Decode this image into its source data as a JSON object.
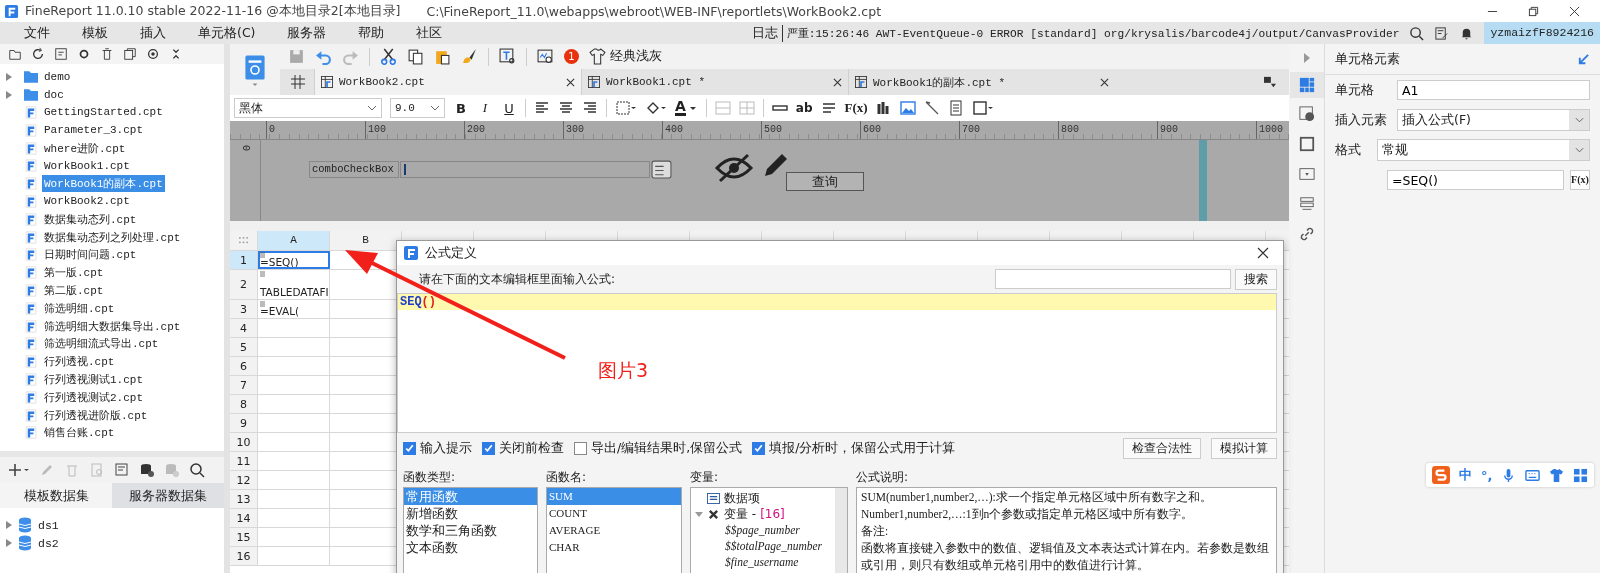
{
  "window": {
    "title": "FineReport 11.0.10 stable 2022-11-16 @本地目录2[本地目录]",
    "path": "C:\\FineReport_11.0\\webapps\\webroot\\WEB-INF\\reportlets\\WorkBook2.cpt"
  },
  "menu": [
    "文件",
    "模板",
    "插入",
    "单元格(C)",
    "服务器",
    "帮助",
    "社区"
  ],
  "status": {
    "log_label": "日志",
    "message": "严重:15:26:46 AWT-EventQueue-0 ERROR [standard] org/krysalis/barcode4j/output/CanvasProvider",
    "user": "yzmaizfF8924216"
  },
  "file_tree": [
    {
      "label": "demo",
      "kind": "folder",
      "selected": false
    },
    {
      "label": "doc",
      "kind": "folder",
      "selected": false
    },
    {
      "label": "GettingStarted.cpt",
      "kind": "file",
      "selected": false
    },
    {
      "label": "Parameter_3.cpt",
      "kind": "file",
      "selected": false
    },
    {
      "label": "where进阶.cpt",
      "kind": "file",
      "selected": false
    },
    {
      "label": "WorkBook1.cpt",
      "kind": "file",
      "selected": false
    },
    {
      "label": "WorkBook1的副本.cpt",
      "kind": "file",
      "selected": true
    },
    {
      "label": "WorkBook2.cpt",
      "kind": "file",
      "selected": false
    },
    {
      "label": "数据集动态列.cpt",
      "kind": "file",
      "selected": false
    },
    {
      "label": "数据集动态列之列处理.cpt",
      "kind": "file",
      "selected": false
    },
    {
      "label": "日期时间问题.cpt",
      "kind": "file",
      "selected": false
    },
    {
      "label": "第一版.cpt",
      "kind": "file",
      "selected": false
    },
    {
      "label": "第二版.cpt",
      "kind": "file",
      "selected": false
    },
    {
      "label": "筛选明细.cpt",
      "kind": "file",
      "selected": false
    },
    {
      "label": "筛选明细大数据集导出.cpt",
      "kind": "file",
      "selected": false
    },
    {
      "label": "筛选明细流式导出.cpt",
      "kind": "file",
      "selected": false
    },
    {
      "label": "行列透视.cpt",
      "kind": "file",
      "selected": false
    },
    {
      "label": "行列透视测试1.cpt",
      "kind": "file",
      "selected": false
    },
    {
      "label": "行列透视测试2.cpt",
      "kind": "file",
      "selected": false
    },
    {
      "label": "行列透视进阶版.cpt",
      "kind": "file",
      "selected": false
    },
    {
      "label": "销售台账.cpt",
      "kind": "file",
      "selected": false
    }
  ],
  "dataset_tabs": [
    {
      "label": "模板数据集",
      "selected": true
    },
    {
      "label": "服务器数据集",
      "selected": false
    }
  ],
  "datasets": [
    "ds1",
    "ds2"
  ],
  "toolbar": {
    "badge": "1",
    "theme_button": "经典浅灰"
  },
  "doc_tabs": [
    {
      "label": "WorkBook2.cpt",
      "selected": true
    },
    {
      "label": "WorkBook1.cpt *",
      "selected": false
    },
    {
      "label": "WorkBook1的副本.cpt *",
      "selected": false
    }
  ],
  "format_bar": {
    "font": "黑体",
    "size": "9.0",
    "style_buttons": [
      "B",
      "I",
      "U"
    ],
    "color_button": "A",
    "wrap_label": "ab",
    "fx_label": "F(x)"
  },
  "designer": {
    "ruler": [
      "0",
      "100",
      "200",
      "300",
      "400",
      "500",
      "600",
      "700",
      "800",
      "900",
      "1000"
    ],
    "vertical_ruler": "0",
    "widget_label": "comboCheckBox",
    "query_button": "查询"
  },
  "sheet": {
    "columns": [
      {
        "label": "A",
        "selected": true
      },
      {
        "label": "B",
        "selected": false
      }
    ],
    "rows": [
      {
        "label": "1",
        "selected": true,
        "cell": "=SEQ()"
      },
      {
        "label": "2",
        "selected": false,
        "cell": "TABLEDATAFI"
      },
      {
        "label": "3",
        "selected": false,
        "cell": "=EVAL("
      },
      {
        "label": "4",
        "selected": false
      },
      {
        "label": "5",
        "selected": false
      },
      {
        "label": "6",
        "selected": false
      },
      {
        "label": "7",
        "selected": false
      },
      {
        "label": "8",
        "selected": false
      },
      {
        "label": "9",
        "selected": false
      },
      {
        "label": "10",
        "selected": false
      },
      {
        "label": "11",
        "selected": false
      },
      {
        "label": "12",
        "selected": false
      },
      {
        "label": "13",
        "selected": false
      },
      {
        "label": "14",
        "selected": false
      },
      {
        "label": "15",
        "selected": false
      },
      {
        "label": "16",
        "selected": false
      }
    ]
  },
  "dialog": {
    "title": "公式定义",
    "prompt": "请在下面的文本编辑框里面输入公式:",
    "search_button": "搜索",
    "formula": {
      "name": "SEQ",
      "args": "()"
    },
    "options": [
      {
        "label": "输入提示",
        "checked": true
      },
      {
        "label": "关闭前检查",
        "checked": true
      },
      {
        "label": "导出/编辑结果时,保留公式",
        "checked": false
      },
      {
        "label": "填报/分析时，保留公式用于计算",
        "checked": true
      }
    ],
    "buttons": [
      "检查合法性",
      "模拟计算"
    ],
    "function_types": {
      "heading": "函数类型:",
      "items": [
        {
          "label": "常用函数",
          "selected": true
        },
        {
          "label": "新增函数",
          "selected": false
        },
        {
          "label": "数学和三角函数",
          "selected": false
        },
        {
          "label": "文本函数",
          "selected": false
        }
      ]
    },
    "function_names": {
      "heading": "函数名:",
      "items": [
        {
          "label": "SUM",
          "selected": true
        },
        {
          "label": "COUNT",
          "selected": false
        },
        {
          "label": "AVERAGE",
          "selected": false
        },
        {
          "label": "CHAR",
          "selected": false
        }
      ]
    },
    "variables": {
      "heading": "变量:",
      "items": [
        {
          "label": "数据项"
        },
        {
          "label": "变量 -",
          "count": "[16]",
          "expanded": true,
          "children": [
            {
              "label": "$$page_number"
            },
            {
              "label": "$$totalPage_number"
            },
            {
              "label": "$fine_username"
            }
          ]
        }
      ]
    },
    "description": {
      "heading": "公式说明:",
      "lines": [
        "SUM(number1,number2,…):求一个指定单元格区域中所有数字之和。",
        "Number1,number2,…:1到n个参数或指定单元格区域中所有数字。",
        "备注:",
        "函数将直接键入参数中的数值、逻辑值及文本表达式计算在内。若参数是数组",
        "或引用，则只有数组或单元格引用中的数值进行计算。"
      ]
    }
  },
  "properties": {
    "heading": "单元格元素",
    "cell_label": "单元格",
    "cell_value": "A1",
    "insert_label": "插入元素",
    "insert_value": "插入公式(F)",
    "format_label": "格式",
    "format_value": "常规",
    "formula_value": "=SEQ()",
    "fx_label": "F(x)"
  },
  "annotation": "图片3",
  "ime": {
    "mode": "中",
    "punct": "°,"
  }
}
